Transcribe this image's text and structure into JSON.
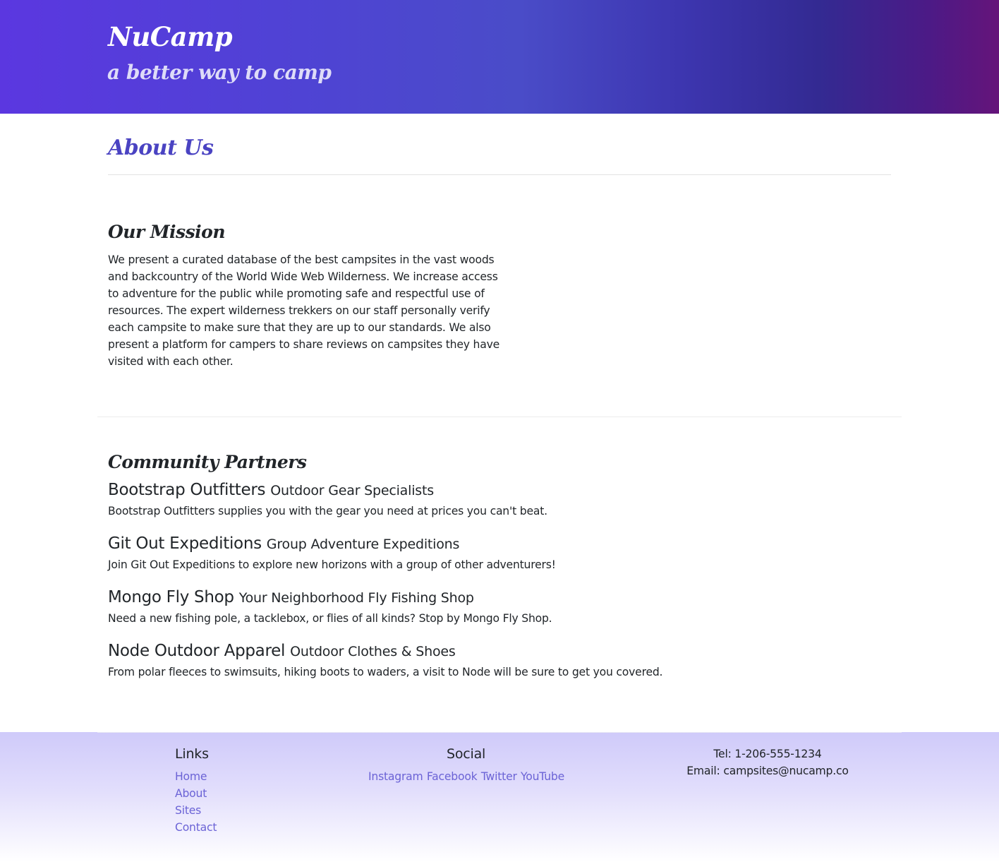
{
  "header": {
    "brand": "NuCamp",
    "tagline": "a better way to camp"
  },
  "page_title": "About Us",
  "mission": {
    "heading": "Our Mission",
    "text": "We present a curated database of the best campsites in the vast woods and backcountry of the World Wide Web Wilderness. We increase access to adventure for the public while promoting safe and respectful use of resources. The expert wilderness trekkers on our staff personally verify each campsite to make sure that they are up to our standards. We also present a platform for campers to share reviews on campsites they have visited with each other."
  },
  "partners": {
    "heading": "Community Partners",
    "items": [
      {
        "name": "Bootstrap Outfitters",
        "subtitle": "Outdoor Gear Specialists",
        "description": "Bootstrap Outfitters supplies you with the gear you need at prices you can't beat."
      },
      {
        "name": "Git Out Expeditions",
        "subtitle": "Group Adventure Expeditions",
        "description": "Join Git Out Expeditions to explore new horizons with a group of other adventurers!"
      },
      {
        "name": "Mongo Fly Shop",
        "subtitle": "Your Neighborhood Fly Fishing Shop",
        "description": "Need a new fishing pole, a tacklebox, or flies of all kinds? Stop by Mongo Fly Shop."
      },
      {
        "name": "Node Outdoor Apparel",
        "subtitle": "Outdoor Clothes & Shoes",
        "description": "From polar fleeces to swimsuits, hiking boots to waders, a visit to Node will be sure to get you covered."
      }
    ]
  },
  "footer": {
    "links_heading": "Links",
    "links": [
      "Home",
      "About",
      "Sites",
      "Contact"
    ],
    "social_heading": "Social",
    "social": [
      "Instagram",
      "Facebook",
      "Twitter",
      "YouTube"
    ],
    "tel": "Tel: 1-206-555-1234",
    "email": "Email: campsites@nucamp.co"
  },
  "colors": {
    "header_gradient_start": "#5b37e0",
    "header_gradient_end": "#65147a",
    "title_color": "#4a43c2",
    "link_color": "#6b63d6",
    "footer_background": "#cfcafa"
  }
}
